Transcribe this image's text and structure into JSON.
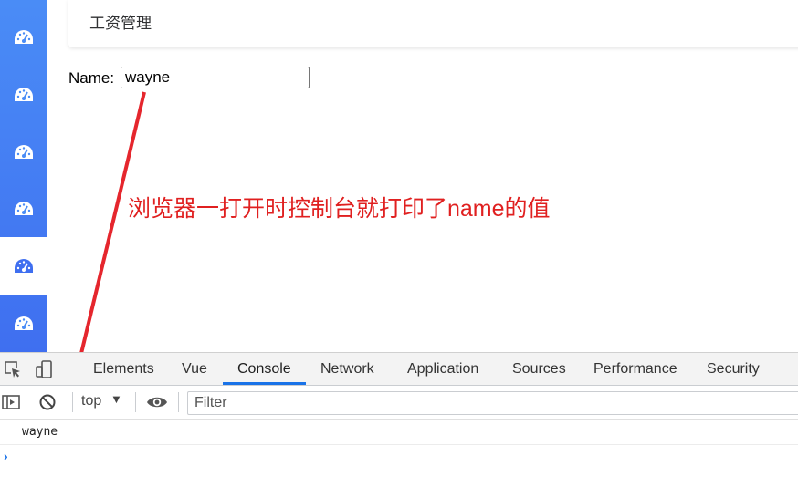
{
  "sidebar": {
    "icon": "gauge-icon",
    "items": [
      {
        "icon": "gauge-icon",
        "active": false
      },
      {
        "icon": "gauge-icon",
        "active": false
      },
      {
        "icon": "gauge-icon",
        "active": false
      },
      {
        "icon": "gauge-icon",
        "active": false
      },
      {
        "icon": "gauge-icon",
        "active": true
      },
      {
        "icon": "gauge-icon",
        "active": false
      }
    ],
    "colors": {
      "background": "#4a8cf6",
      "active_background": "#ffffff"
    }
  },
  "header": {
    "title": "工资管理"
  },
  "form": {
    "name_label": "Name:",
    "name_value": "wayne"
  },
  "annotation": {
    "text": "浏览器一打开时控制台就打印了name的值",
    "color": "#e02020"
  },
  "devtools": {
    "tabs": [
      "Elements",
      "Vue",
      "Console",
      "Network",
      "Application",
      "Sources",
      "Performance",
      "Security"
    ],
    "active_tab": "Console",
    "context": "top",
    "filter_placeholder": "Filter",
    "console_output": [
      "wayne"
    ],
    "prompt": "›",
    "accent_color": "#1a73e8"
  }
}
